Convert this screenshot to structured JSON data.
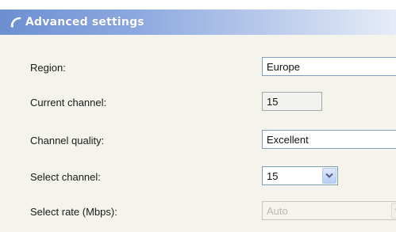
{
  "window": {
    "title": "Advanced settings"
  },
  "icons": {
    "title_icon": "wifi-signal-icon",
    "dropdown_arrow": "chevron-down-icon"
  },
  "colors": {
    "title_bar_start": "#6c8fd2",
    "title_bar_end": "#e6ecf7",
    "panel_background": "#f4f3ec",
    "input_border": "#7f9db9"
  },
  "settings": {
    "region": {
      "label": "Region:",
      "value": "Europe"
    },
    "current_channel": {
      "label": "Current channel:",
      "value": "15"
    },
    "channel_quality": {
      "label": "Channel quality:",
      "value": "Excellent"
    },
    "select_channel": {
      "label": "Select channel:",
      "value": "15"
    },
    "select_rate": {
      "label": "Select rate (Mbps):",
      "value": "Auto"
    }
  }
}
